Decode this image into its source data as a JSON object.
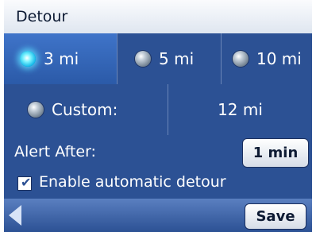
{
  "header": {
    "title": "Detour"
  },
  "distance_options": [
    {
      "label": "3 mi",
      "selected": true
    },
    {
      "label": "5 mi",
      "selected": false
    },
    {
      "label": "10 mi",
      "selected": false
    }
  ],
  "custom": {
    "label": "Custom:",
    "value": "12 mi",
    "selected": false
  },
  "alert": {
    "label": "Alert After:",
    "value": "1 min"
  },
  "auto_detour": {
    "label": "Enable automatic detour",
    "checked": true
  },
  "footer": {
    "save_label": "Save"
  },
  "colors": {
    "panel": "#2c5194",
    "title_bar": "#dfe6f0",
    "selected_glow": "#13b8e8"
  }
}
